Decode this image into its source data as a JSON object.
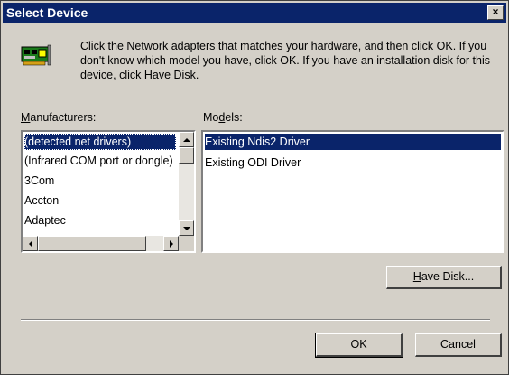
{
  "window": {
    "title": "Select Device",
    "close_label": "×"
  },
  "description": "Click the Network adapters that matches your hardware, and then click OK. If you don't know which model you have, click OK. If you have an installation disk for this device, click Have Disk.",
  "manufacturers": {
    "label_mnemonic": "M",
    "label_rest": "anufacturers:",
    "items": [
      "(detected net drivers)",
      "(Infrared COM port or dongle)",
      "3Com",
      "Accton",
      "Adaptec"
    ],
    "selected_index": 0
  },
  "models": {
    "label_pre": "Mo",
    "label_mnemonic": "d",
    "label_post": "els:",
    "items": [
      "Existing Ndis2 Driver",
      "Existing ODI Driver"
    ],
    "selected_index": 0
  },
  "buttons": {
    "have_disk_mnemonic": "H",
    "have_disk_rest": "ave Disk...",
    "ok": "OK",
    "cancel": "Cancel"
  },
  "icons": {
    "adapter": "network-adapter-icon"
  }
}
